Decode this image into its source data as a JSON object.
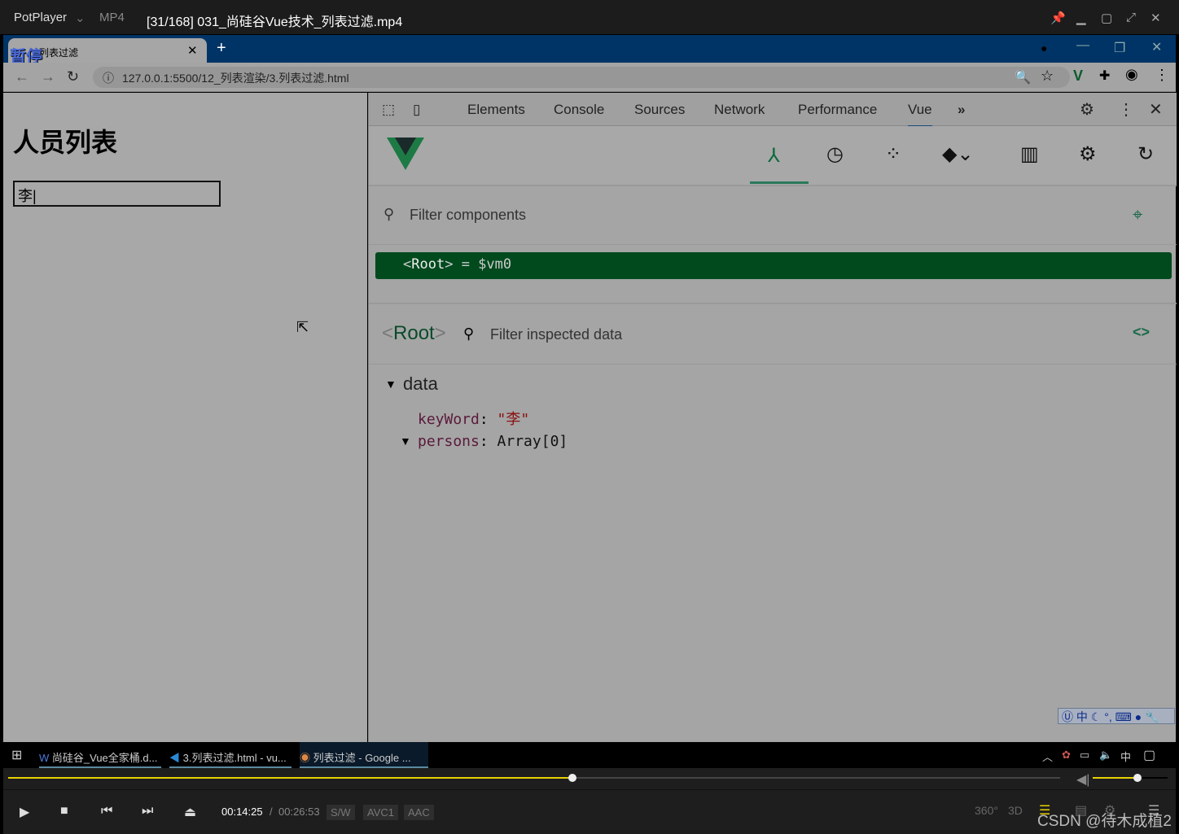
{
  "player": {
    "brand": "PotPlayer",
    "format": "MP4",
    "title": "[31/168] 031_尚硅谷Vue技术_列表过滤.mp4",
    "paused_label": "暂停"
  },
  "browser": {
    "tab_title": "列表过滤",
    "url": "127.0.0.1:5500/12_列表渲染/3.列表过滤.html"
  },
  "page": {
    "heading": "人员列表",
    "input_value": "李"
  },
  "devtools": {
    "tabs": [
      "Elements",
      "Console",
      "Sources",
      "Network",
      "Performance",
      "Vue"
    ],
    "active_tab": "Vue",
    "filter_components_placeholder": "Filter components",
    "root_label": "Root",
    "root_var": "= $vm0",
    "inspected_title": "Root",
    "filter_inspected_placeholder": "Filter inspected data",
    "section": "data",
    "fields": [
      {
        "key": "keyWord",
        "value": "\"李\""
      },
      {
        "key": "persons",
        "value": "Array[0]"
      }
    ],
    "accent": "#42b883"
  },
  "ime": {
    "label": "中"
  },
  "taskbar": {
    "items": [
      "尚硅谷_Vue全家桶.d...",
      "3.列表过滤.html - vu...",
      "列表过滤 - Google ..."
    ],
    "tray_lang": "中"
  },
  "controls": {
    "current_time": "00:14:25",
    "total_time": "00:26:53",
    "badges": [
      "S/W",
      "AVC1",
      "AAC"
    ],
    "progress_percent": 53.6,
    "volume_percent": 60,
    "right_labels": [
      "360°",
      "3D"
    ]
  },
  "watermark": "CSDN @待木成植2"
}
